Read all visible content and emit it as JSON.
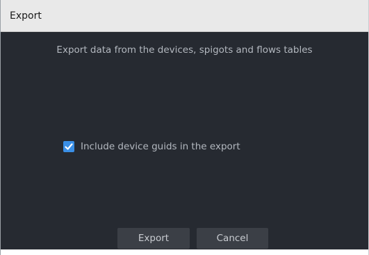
{
  "window": {
    "title": "Export"
  },
  "dialog": {
    "description": "Export data from the devices, spigots and flows tables",
    "include_guids": {
      "label": "Include device guids in the export",
      "checked": true
    }
  },
  "buttons": {
    "export_label": "Export",
    "cancel_label": "Cancel"
  },
  "colors": {
    "background": "#262a31",
    "titlebar": "#e9e9e9",
    "accent": "#3a8fe6",
    "button": "#3b3f46",
    "text": "#b3b8bf"
  },
  "icons": {
    "checkbox": "check-icon"
  }
}
